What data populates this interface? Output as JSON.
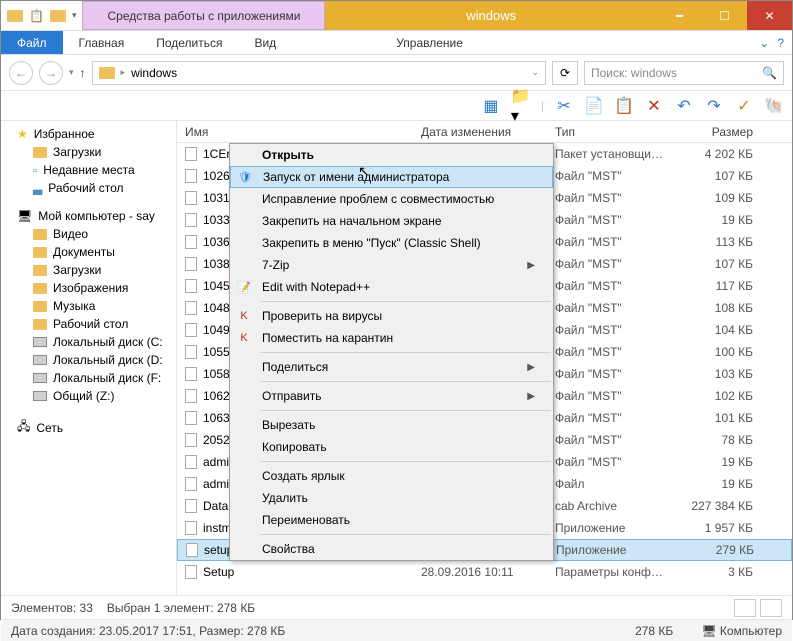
{
  "window": {
    "app_tools": "Средства работы с приложениями",
    "title": "windows"
  },
  "ribbon": {
    "file": "Файл",
    "home": "Главная",
    "share": "Поделиться",
    "view": "Вид",
    "manage": "Управление"
  },
  "address": {
    "path": "windows",
    "search_placeholder": "Поиск: windows"
  },
  "columns": {
    "name": "Имя",
    "date": "Дата изменения",
    "type": "Тип",
    "size": "Размер"
  },
  "sidebar": {
    "favorites": "Избранное",
    "downloads": "Загрузки",
    "recent": "Недавние места",
    "desktop": "Рабочий стол",
    "computer": "Мой компьютер - say",
    "videos": "Видео",
    "documents": "Документы",
    "downloads2": "Загрузки",
    "pictures": "Изображения",
    "music": "Музыка",
    "desktop2": "Рабочий стол",
    "disk_c": "Локальный диск (C:",
    "disk_d": "Локальный диск (D:",
    "disk_f": "Локальный диск (F:",
    "disk_z": "Общий (Z:)",
    "network": "Сеть"
  },
  "files": [
    {
      "name": "1CEnt",
      "type": "Пакет установщи…",
      "size": "4 202 КБ"
    },
    {
      "name": "1026.",
      "type": "Файл \"MST\"",
      "size": "107 КБ"
    },
    {
      "name": "1031.",
      "type": "Файл \"MST\"",
      "size": "109 КБ"
    },
    {
      "name": "1033.",
      "type": "Файл \"MST\"",
      "size": "19 КБ"
    },
    {
      "name": "1036.",
      "type": "Файл \"MST\"",
      "size": "113 КБ"
    },
    {
      "name": "1038.",
      "type": "Файл \"MST\"",
      "size": "107 КБ"
    },
    {
      "name": "1045.",
      "type": "Файл \"MST\"",
      "size": "117 КБ"
    },
    {
      "name": "1048.",
      "type": "Файл \"MST\"",
      "size": "108 КБ"
    },
    {
      "name": "1049.",
      "type": "Файл \"MST\"",
      "size": "104 КБ"
    },
    {
      "name": "1055.",
      "type": "Файл \"MST\"",
      "size": "100 КБ"
    },
    {
      "name": "1058.",
      "type": "Файл \"MST\"",
      "size": "103 КБ"
    },
    {
      "name": "1062.",
      "type": "Файл \"MST\"",
      "size": "102 КБ"
    },
    {
      "name": "1063.",
      "type": "Файл \"MST\"",
      "size": "101 КБ"
    },
    {
      "name": "2052.",
      "type": "Файл \"MST\"",
      "size": "78 КБ"
    },
    {
      "name": "admin",
      "type": "Файл \"MST\"",
      "size": "19 КБ"
    },
    {
      "name": "admin",
      "type": "Файл",
      "size": "19 КБ"
    },
    {
      "name": "Data1",
      "type": "cab Archive",
      "size": "227 384 КБ"
    },
    {
      "name": "instm",
      "type": "Приложение",
      "size": "1 957 КБ"
    },
    {
      "name": "setup",
      "date": "",
      "type": "Приложение",
      "size": "279 КБ",
      "selected": true
    },
    {
      "name": "Setup",
      "date": "28.09.2016 10:11",
      "type": "Параметры конф…",
      "size": "3 КБ"
    }
  ],
  "context_menu": {
    "open": "Открыть",
    "run_as_admin": "Запуск от имени администратора",
    "troubleshoot": "Исправление проблем с совместимостью",
    "pin_start": "Закрепить на начальном экране",
    "pin_classic": "Закрепить в меню \"Пуск\" (Classic Shell)",
    "seven_zip": "7-Zip",
    "notepad": "Edit with Notepad++",
    "virus_check": "Проверить на вирусы",
    "quarantine": "Поместить на карантин",
    "share": "Поделиться",
    "send_to": "Отправить",
    "cut": "Вырезать",
    "copy": "Копировать",
    "shortcut": "Создать ярлык",
    "delete": "Удалить",
    "rename": "Переименовать",
    "properties": "Свойства"
  },
  "status": {
    "elements": "Элементов: 33",
    "selected": "Выбран 1 элемент: 278 КБ",
    "details": "Дата создания: 23.05.2017 17:51, Размер: 278 КБ",
    "size": "278 КБ",
    "computer": "Компьютер"
  }
}
